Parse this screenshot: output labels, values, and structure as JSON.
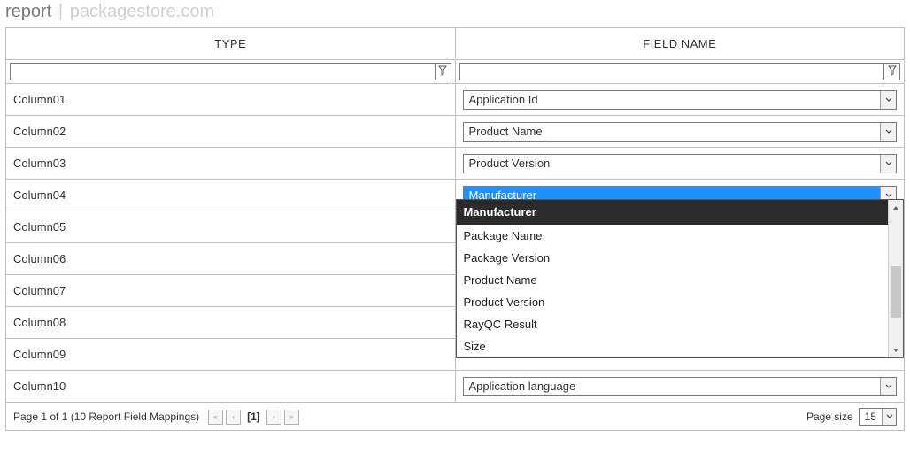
{
  "header": {
    "title": "report",
    "subtitle": "packagestore.com"
  },
  "columns": {
    "type": "TYPE",
    "field": "FIELD NAME"
  },
  "rows": [
    {
      "type": "Column01",
      "field": "Application Id"
    },
    {
      "type": "Column02",
      "field": "Product Name"
    },
    {
      "type": "Column03",
      "field": "Product Version"
    },
    {
      "type": "Column04",
      "field": "Manufacturer",
      "open": true
    },
    {
      "type": "Column05",
      "field": ""
    },
    {
      "type": "Column06",
      "field": ""
    },
    {
      "type": "Column07",
      "field": ""
    },
    {
      "type": "Column08",
      "field": ""
    },
    {
      "type": "Column09",
      "field": ""
    },
    {
      "type": "Column10",
      "field": "Application language"
    }
  ],
  "dropdown": {
    "options": [
      "Manufacturer",
      "Package Name",
      "Package Version",
      "Product Name",
      "Product Version",
      "RayQC Result",
      "Size"
    ],
    "selected_index": 0
  },
  "footer": {
    "status": "Page 1 of 1 (10 Report Field Mappings)",
    "current_page": "[1]",
    "page_size_label": "Page size",
    "page_size_value": "15"
  }
}
